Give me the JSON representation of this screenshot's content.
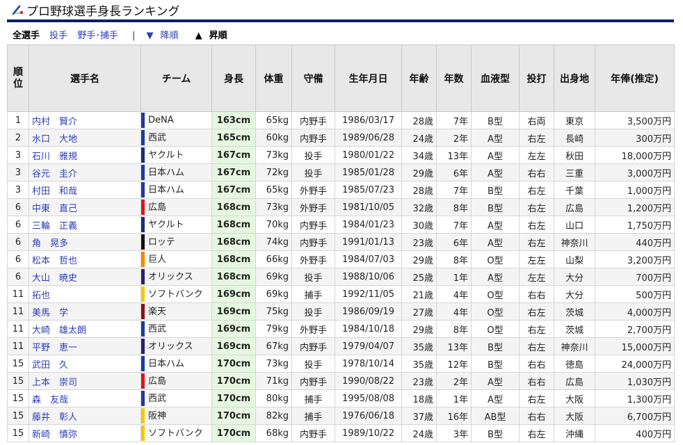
{
  "title": "プロ野球選手身長ランキング",
  "filters": {
    "all": "全選手",
    "pitchers": "投手",
    "fielders": "野手･捕手",
    "sep": "|",
    "desc": "降順",
    "asc": "昇順"
  },
  "columns": [
    "順位",
    "選手名",
    "チーム",
    "身長",
    "体重",
    "守備",
    "生年月日",
    "年齢",
    "年数",
    "血液型",
    "投打",
    "出身地",
    "年俸(推定)"
  ],
  "team_colors": {
    "DeNA": "#1a3aa8",
    "西武": "#1a3aa8",
    "ヤクルト": "#1a2d7a",
    "日本ハム": "#1a3aa8",
    "広島": "#d8151c",
    "ロッテ": "#111111",
    "巨人": "#f08a00",
    "オリックス": "#2a1f7a",
    "ソフトバンク": "#f5c800",
    "楽天": "#8a1020",
    "阪神": "#f5c800"
  },
  "rows": [
    {
      "rank": "1",
      "name": "内村　賢介",
      "team": "DeNA",
      "height": "163cm",
      "weight": "65kg",
      "position": "内野手",
      "birth": "1986/03/17",
      "age": "28歳",
      "years": "7年",
      "blood": "B型",
      "bt": "右両",
      "origin": "東京",
      "salary": "3,500万円"
    },
    {
      "rank": "2",
      "name": "水口　大地",
      "team": "西武",
      "height": "165cm",
      "weight": "60kg",
      "position": "内野手",
      "birth": "1989/06/28",
      "age": "24歳",
      "years": "2年",
      "blood": "A型",
      "bt": "右左",
      "origin": "長崎",
      "salary": "300万円"
    },
    {
      "rank": "3",
      "name": "石川　雅規",
      "team": "ヤクルト",
      "height": "167cm",
      "weight": "73kg",
      "position": "投手",
      "birth": "1980/01/22",
      "age": "34歳",
      "years": "13年",
      "blood": "A型",
      "bt": "左左",
      "origin": "秋田",
      "salary": "18,000万円"
    },
    {
      "rank": "3",
      "name": "谷元　圭介",
      "team": "日本ハム",
      "height": "167cm",
      "weight": "72kg",
      "position": "投手",
      "birth": "1985/01/28",
      "age": "29歳",
      "years": "6年",
      "blood": "A型",
      "bt": "右右",
      "origin": "三重",
      "salary": "3,000万円"
    },
    {
      "rank": "3",
      "name": "村田　和哉",
      "team": "日本ハム",
      "height": "167cm",
      "weight": "65kg",
      "position": "外野手",
      "birth": "1985/07/23",
      "age": "28歳",
      "years": "7年",
      "blood": "B型",
      "bt": "右左",
      "origin": "千葉",
      "salary": "1,000万円"
    },
    {
      "rank": "6",
      "name": "中東　直己",
      "team": "広島",
      "height": "168cm",
      "weight": "73kg",
      "position": "外野手",
      "birth": "1981/10/05",
      "age": "32歳",
      "years": "8年",
      "blood": "B型",
      "bt": "右左",
      "origin": "広島",
      "salary": "1,200万円"
    },
    {
      "rank": "6",
      "name": "三輪　正義",
      "team": "ヤクルト",
      "height": "168cm",
      "weight": "70kg",
      "position": "内野手",
      "birth": "1984/01/23",
      "age": "30歳",
      "years": "7年",
      "blood": "A型",
      "bt": "右左",
      "origin": "山口",
      "salary": "1,750万円"
    },
    {
      "rank": "6",
      "name": "角　晃多",
      "team": "ロッテ",
      "height": "168cm",
      "weight": "74kg",
      "position": "内野手",
      "birth": "1991/01/13",
      "age": "23歳",
      "years": "6年",
      "blood": "A型",
      "bt": "右左",
      "origin": "神奈川",
      "salary": "440万円"
    },
    {
      "rank": "6",
      "name": "松本　哲也",
      "team": "巨人",
      "height": "168cm",
      "weight": "66kg",
      "position": "外野手",
      "birth": "1984/07/03",
      "age": "29歳",
      "years": "8年",
      "blood": "O型",
      "bt": "左左",
      "origin": "山梨",
      "salary": "3,200万円"
    },
    {
      "rank": "6",
      "name": "大山　暁史",
      "team": "オリックス",
      "height": "168cm",
      "weight": "69kg",
      "position": "投手",
      "birth": "1988/10/06",
      "age": "25歳",
      "years": "1年",
      "blood": "A型",
      "bt": "左左",
      "origin": "大分",
      "salary": "700万円"
    },
    {
      "rank": "11",
      "name": "拓也",
      "team": "ソフトバンク",
      "height": "169cm",
      "weight": "69kg",
      "position": "捕手",
      "birth": "1992/11/05",
      "age": "21歳",
      "years": "4年",
      "blood": "O型",
      "bt": "右右",
      "origin": "大分",
      "salary": "500万円"
    },
    {
      "rank": "11",
      "name": "美馬　学",
      "team": "楽天",
      "height": "169cm",
      "weight": "75kg",
      "position": "投手",
      "birth": "1986/09/19",
      "age": "27歳",
      "years": "4年",
      "blood": "O型",
      "bt": "右左",
      "origin": "茨城",
      "salary": "4,000万円"
    },
    {
      "rank": "11",
      "name": "大崎　雄太朗",
      "team": "西武",
      "height": "169cm",
      "weight": "79kg",
      "position": "外野手",
      "birth": "1984/10/18",
      "age": "29歳",
      "years": "8年",
      "blood": "O型",
      "bt": "右左",
      "origin": "茨城",
      "salary": "2,700万円"
    },
    {
      "rank": "11",
      "name": "平野　恵一",
      "team": "オリックス",
      "height": "169cm",
      "weight": "67kg",
      "position": "内野手",
      "birth": "1979/04/07",
      "age": "35歳",
      "years": "13年",
      "blood": "B型",
      "bt": "右左",
      "origin": "神奈川",
      "salary": "15,000万円"
    },
    {
      "rank": "15",
      "name": "武田　久",
      "team": "日本ハム",
      "height": "170cm",
      "weight": "73kg",
      "position": "投手",
      "birth": "1978/10/14",
      "age": "35歳",
      "years": "12年",
      "blood": "B型",
      "bt": "右右",
      "origin": "徳島",
      "salary": "24,000万円"
    },
    {
      "rank": "15",
      "name": "上本　崇司",
      "team": "広島",
      "height": "170cm",
      "weight": "71kg",
      "position": "内野手",
      "birth": "1990/08/22",
      "age": "23歳",
      "years": "2年",
      "blood": "A型",
      "bt": "右右",
      "origin": "広島",
      "salary": "1,030万円"
    },
    {
      "rank": "15",
      "name": "森　友哉",
      "team": "西武",
      "height": "170cm",
      "weight": "80kg",
      "position": "捕手",
      "birth": "1995/08/08",
      "age": "18歳",
      "years": "1年",
      "blood": "A型",
      "bt": "右左",
      "origin": "大阪",
      "salary": "1,300万円"
    },
    {
      "rank": "15",
      "name": "藤井　彰人",
      "team": "阪神",
      "height": "170cm",
      "weight": "82kg",
      "position": "捕手",
      "birth": "1976/06/18",
      "age": "37歳",
      "years": "16年",
      "blood": "AB型",
      "bt": "右右",
      "origin": "大阪",
      "salary": "6,700万円"
    },
    {
      "rank": "15",
      "name": "新崎　慎弥",
      "team": "ソフトバンク",
      "height": "170cm",
      "weight": "68kg",
      "position": "内野手",
      "birth": "1989/10/22",
      "age": "24歳",
      "years": "3年",
      "blood": "B型",
      "bt": "右左",
      "origin": "沖縄",
      "salary": "400万円"
    }
  ]
}
